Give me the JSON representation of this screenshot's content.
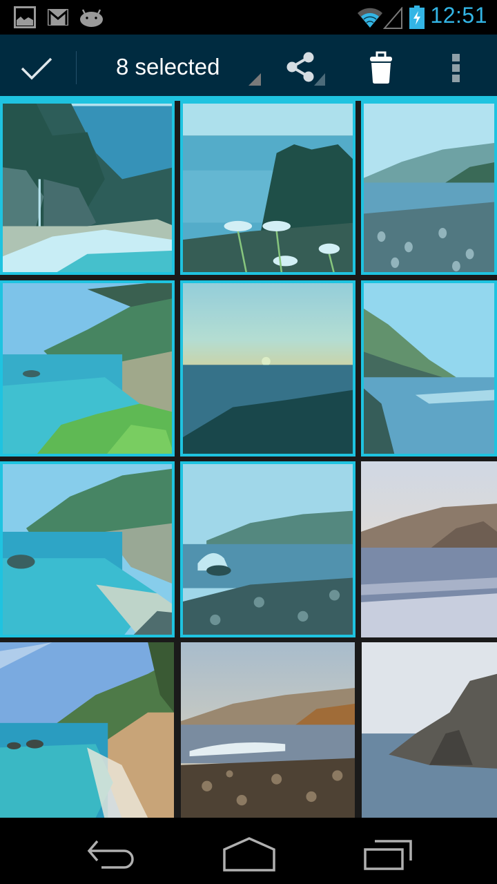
{
  "status_bar": {
    "notifications": [
      {
        "name": "gallery-notification-icon"
      },
      {
        "name": "gmail-notification-icon"
      },
      {
        "name": "android-debug-icon"
      }
    ],
    "wifi": "wifi-icon",
    "signal": "cell-signal-icon",
    "battery": "battery-charging-icon",
    "time": "12:51",
    "accent_color": "#33b5e5"
  },
  "action_bar": {
    "done_icon": "checkmark-icon",
    "title": "8 selected",
    "actions": [
      {
        "name": "share",
        "icon": "share-icon"
      },
      {
        "name": "delete",
        "icon": "trash-icon"
      },
      {
        "name": "overflow",
        "icon": "overflow-menu-icon"
      }
    ],
    "background_color": "#002b40",
    "selection_color": "#1fc3e0"
  },
  "grid": {
    "selected_count": 8,
    "columns": 3,
    "tiles": [
      {
        "scene": "waterfall-cove",
        "selected": true
      },
      {
        "scene": "daisies-ocean",
        "selected": true
      },
      {
        "scene": "coast-hills-rocks",
        "selected": true
      },
      {
        "scene": "turquoise-cove-branches",
        "selected": true
      },
      {
        "scene": "sunset-ocean",
        "selected": true
      },
      {
        "scene": "cliff-coast-waves",
        "selected": true
      },
      {
        "scene": "turquoise-bay",
        "selected": true
      },
      {
        "scene": "wave-rocks-hills",
        "selected": true
      },
      {
        "scene": "hazy-coast-surf",
        "selected": false
      },
      {
        "scene": "blue-sky-cove",
        "selected": false
      },
      {
        "scene": "golden-rocky-beach",
        "selected": false
      },
      {
        "scene": "misty-headland",
        "selected": false
      }
    ]
  },
  "nav_bar": {
    "buttons": [
      {
        "name": "back",
        "icon": "back-icon"
      },
      {
        "name": "home",
        "icon": "home-icon"
      },
      {
        "name": "recents",
        "icon": "recent-apps-icon"
      }
    ]
  }
}
